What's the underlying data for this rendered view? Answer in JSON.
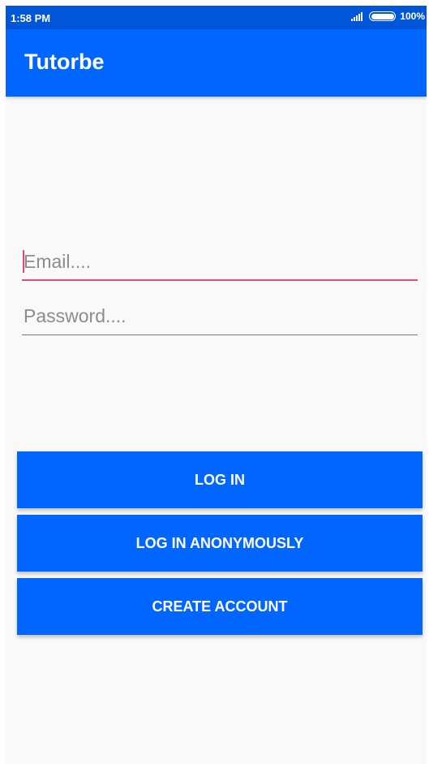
{
  "status_bar": {
    "time": "1:58 PM",
    "battery": "100%",
    "icons": [
      "signal-icon",
      "battery-icon"
    ]
  },
  "app_bar": {
    "title": "Tutorbe"
  },
  "form": {
    "email_placeholder": "Email....",
    "password_placeholder": "Password...."
  },
  "buttons": {
    "log_in": "LOG IN",
    "log_in_anonymously": "LOG IN ANONYMOUSLY",
    "create_account": "CREATE ACCOUNT"
  },
  "colors": {
    "status_bar": "#0055d9",
    "primary": "#0066ff",
    "accent": "#e2497f",
    "background": "#f9f9f9"
  }
}
